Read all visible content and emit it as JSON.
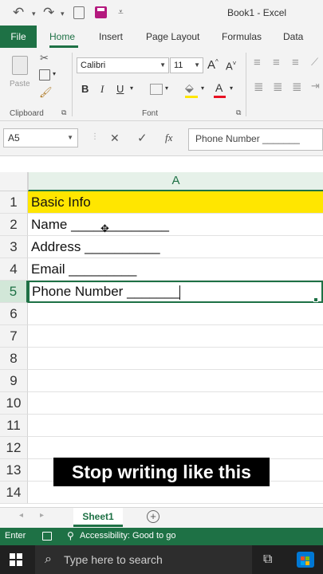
{
  "window": {
    "title": "Book1 - Excel",
    "quick_access": [
      "undo-icon",
      "redo-icon",
      "print-preview-icon",
      "save-icon",
      "customize-icon"
    ]
  },
  "tabs": [
    "File",
    "Home",
    "Insert",
    "Page Layout",
    "Formulas",
    "Data"
  ],
  "active_tab": "Home",
  "ribbon": {
    "clipboard": {
      "label": "Clipboard",
      "paste_label": "Paste"
    },
    "font": {
      "label": "Font",
      "font_name": "Calibri",
      "font_size": "11",
      "bold": "B",
      "italic": "I",
      "underline": "U",
      "increase": "A",
      "decrease": "A",
      "font_color_letter": "A"
    },
    "colors": {
      "accent": "#1e7145",
      "highlight_yellow": "#ffe600",
      "font_color_red": "#e81123"
    }
  },
  "formula_bar": {
    "name_box": "A5",
    "cancel": "✕",
    "enter": "✓",
    "fx": "fx",
    "value": "Phone Number _______"
  },
  "sheet": {
    "column_header": "A",
    "rows": [
      {
        "num": "1",
        "text": "Basic Info"
      },
      {
        "num": "2",
        "text": "Name _____________"
      },
      {
        "num": "3",
        "text": "Address __________"
      },
      {
        "num": "4",
        "text": "Email _________"
      },
      {
        "num": "5",
        "text": "Phone Number _______"
      },
      {
        "num": "6",
        "text": ""
      },
      {
        "num": "7",
        "text": ""
      },
      {
        "num": "8",
        "text": ""
      },
      {
        "num": "9",
        "text": ""
      },
      {
        "num": "10",
        "text": ""
      },
      {
        "num": "11",
        "text": ""
      },
      {
        "num": "12",
        "text": ""
      },
      {
        "num": "13",
        "text": ""
      },
      {
        "num": "14",
        "text": ""
      }
    ],
    "active_cell": "A5",
    "caption": "Stop writing like this",
    "sheet_tab": "Sheet1",
    "add_sheet": "+"
  },
  "status_bar": {
    "mode": "Enter",
    "accessibility": "Accessibility: Good to go"
  },
  "taskbar": {
    "search_placeholder": "Type here to search"
  }
}
